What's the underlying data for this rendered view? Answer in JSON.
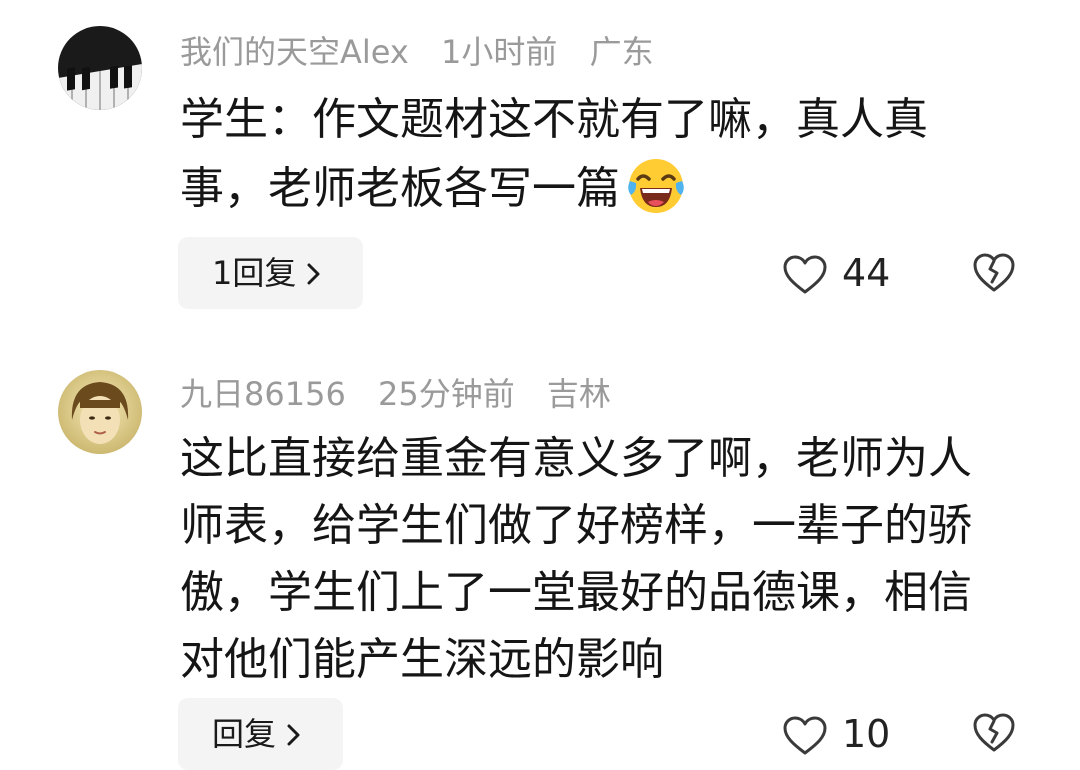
{
  "comments": [
    {
      "username": "我们的天空Alex",
      "time": "1小时前",
      "location": "广东",
      "text": "学生：作文题材这不就有了嘛，真人真事，老师老板各写一篇",
      "emoji": "laughing-tears-emoji",
      "reply_label": "1回复",
      "likes": "44"
    },
    {
      "username": "九日86156",
      "time": "25分钟前",
      "location": "吉林",
      "text": "这比直接给重金有意义多了啊，老师为人师表，给学生们做了好榜样，一辈子的骄傲，学生们上了一堂最好的品德课，相信对他们能产生深远的影响",
      "reply_label": "回复",
      "likes": "10"
    }
  ],
  "colors": {
    "meta": "#9a9a9a",
    "text": "#151515",
    "reply_bg": "#f4f4f4",
    "icon": "#3a3a3a"
  }
}
